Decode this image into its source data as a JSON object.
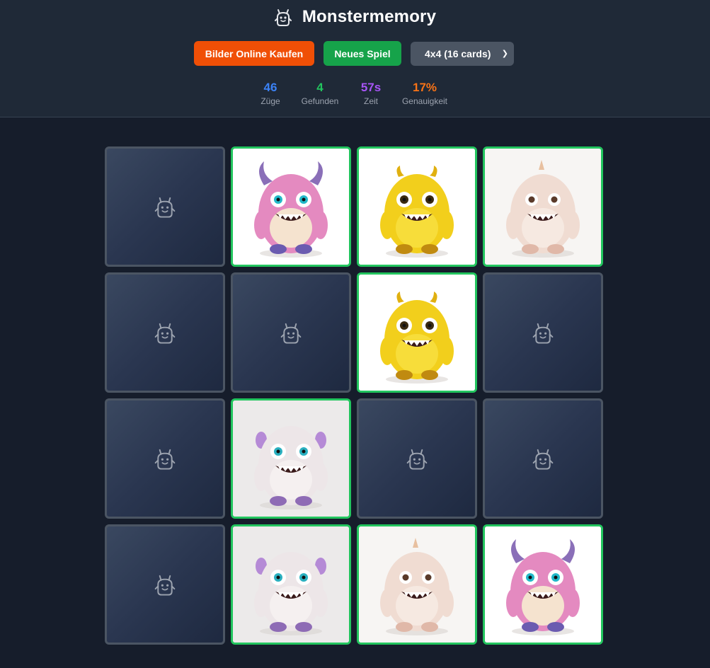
{
  "app": {
    "title": "Monstermemory",
    "icon": "monster-icon"
  },
  "controls": {
    "buy_label": "Bilder Online Kaufen",
    "new_game_label": "Neues Spiel",
    "size_selected": "4x4 (16 cards)"
  },
  "stats": [
    {
      "value": "46",
      "label": "Züge",
      "color": "#3b82f6"
    },
    {
      "value": "4",
      "label": "Gefunden",
      "color": "#22c55e"
    },
    {
      "value": "57s",
      "label": "Zeit",
      "color": "#a855f7"
    },
    {
      "value": "17%",
      "label": "Genauigkeit",
      "color": "#f97316"
    }
  ],
  "colors": {
    "accent_buy": "#f04f06",
    "accent_new": "#16a34a",
    "matched_border": "#22c55e",
    "hidden_border": "#4b5563"
  },
  "cards": [
    {
      "state": "hidden",
      "monster": ""
    },
    {
      "state": "matched",
      "monster": "pink"
    },
    {
      "state": "matched",
      "monster": "yellow"
    },
    {
      "state": "matched",
      "monster": "cream"
    },
    {
      "state": "hidden",
      "monster": ""
    },
    {
      "state": "hidden",
      "monster": ""
    },
    {
      "state": "matched",
      "monster": "yellow"
    },
    {
      "state": "hidden",
      "monster": ""
    },
    {
      "state": "hidden",
      "monster": ""
    },
    {
      "state": "matched",
      "monster": "white"
    },
    {
      "state": "hidden",
      "monster": ""
    },
    {
      "state": "hidden",
      "monster": ""
    },
    {
      "state": "hidden",
      "monster": ""
    },
    {
      "state": "matched",
      "monster": "white"
    },
    {
      "state": "matched",
      "monster": "cream"
    },
    {
      "state": "matched",
      "monster": "pink"
    }
  ]
}
